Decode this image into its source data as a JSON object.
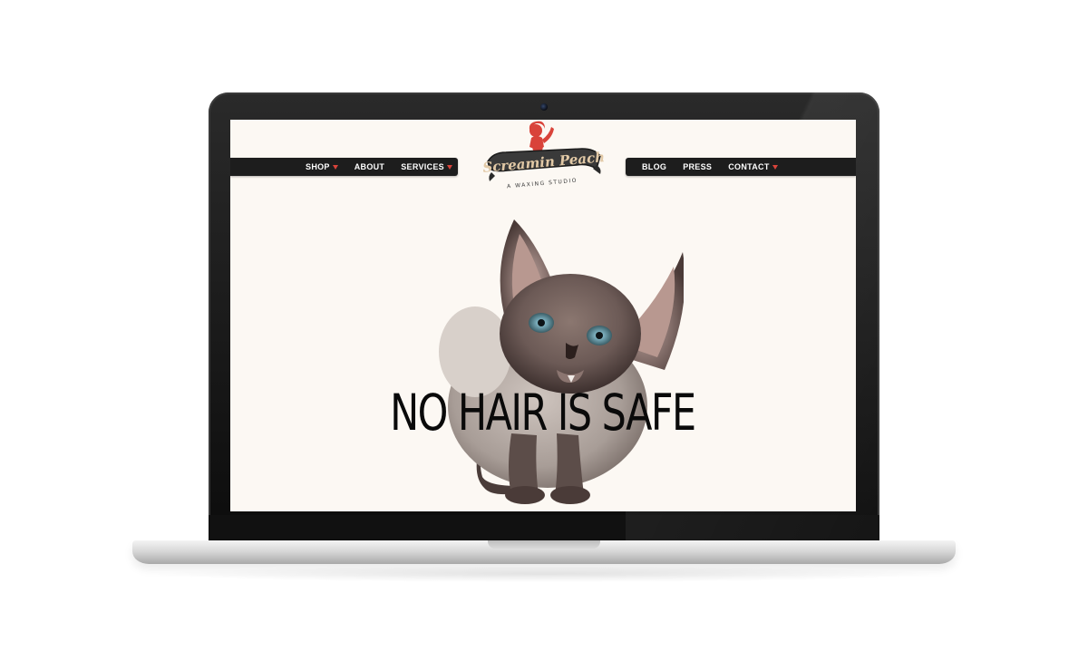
{
  "site": {
    "brand_name": "Screamin Peach",
    "brand_tagline": "A WAXING STUDIO",
    "hero_headline": "NO HAIR IS SAFE"
  },
  "nav": {
    "left": [
      {
        "label": "SHOP",
        "dropdown": true
      },
      {
        "label": "ABOUT",
        "dropdown": false
      },
      {
        "label": "SERVICES",
        "dropdown": true
      }
    ],
    "right": [
      {
        "label": "BLOG",
        "dropdown": false
      },
      {
        "label": "PRESS",
        "dropdown": false
      },
      {
        "label": "CONTACT",
        "dropdown": true
      }
    ]
  },
  "colors": {
    "accent_red": "#d9433a",
    "nav_background": "#1d1d1d",
    "page_background": "#fcf8f3",
    "headline_text": "#0a0a0a"
  },
  "icons": {
    "dropdown": "caret-down-icon",
    "webcam": "camera-icon",
    "logo_mascot": "pinup-girl-icon"
  }
}
